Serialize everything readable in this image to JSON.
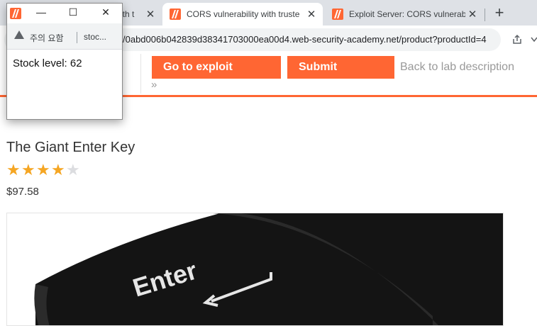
{
  "browser": {
    "tabs": [
      {
        "title": "ith t"
      },
      {
        "title": "CORS vulnerability with truste"
      },
      {
        "title": "Exploit Server: CORS vulnerab"
      }
    ],
    "close_glyph": "✕",
    "new_tab_glyph": "+",
    "url": "/0abd006b042839d38341703000ea00d4.web-security-academy.net/product?productId=4",
    "share_icon": "share-icon",
    "menu_icon": "chevron-down-icon"
  },
  "lab": {
    "exploit_button": "Go to exploit server",
    "submit_button": "Submit solution",
    "back_link": "Back to lab description",
    "chevrons": "»",
    "accent": "#ff6633"
  },
  "product": {
    "title": "The Giant Enter Key",
    "rating": 4,
    "max_rating": 5,
    "star_glyph": "★",
    "price": "$97.58",
    "image_text": "Enter"
  },
  "popup": {
    "warning": "주의 요함",
    "url": "stoc...",
    "stock_text": "Stock level: 62",
    "minimize": "—",
    "maximize": "☐",
    "close": "✕"
  }
}
